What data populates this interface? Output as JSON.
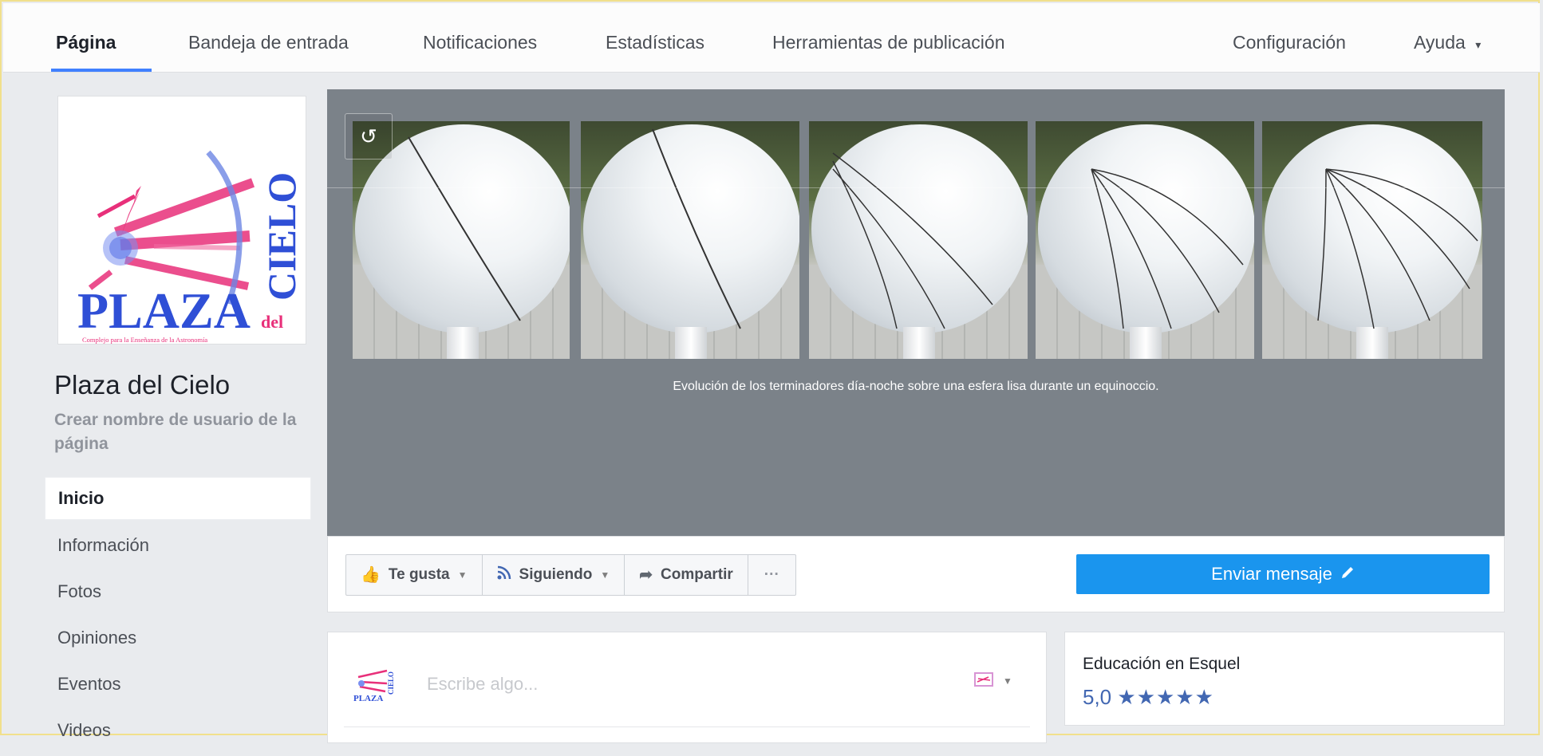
{
  "topnav": {
    "tabs": [
      {
        "label": "Página"
      },
      {
        "label": "Bandeja de entrada"
      },
      {
        "label": "Notificaciones"
      },
      {
        "label": "Estadísticas"
      },
      {
        "label": "Herramientas de publicación"
      }
    ],
    "settings_label": "Configuración",
    "help_label": "Ayuda",
    "help_caret": "▾"
  },
  "page": {
    "name": "Plaza del Cielo",
    "create_username": "Crear nombre de usuario de la página",
    "logo": {
      "word_plaza": "PLAZA",
      "word_del": "del",
      "word_cielo": "CIELO",
      "tagline": "Complejo para la Enseñanza de la Astronomía"
    }
  },
  "sidebar": {
    "items": [
      {
        "label": "Inicio"
      },
      {
        "label": "Información"
      },
      {
        "label": "Fotos"
      },
      {
        "label": "Opiniones"
      },
      {
        "label": "Eventos"
      },
      {
        "label": "Videos"
      }
    ]
  },
  "cover": {
    "caption": "Evolución de los terminadores día-noche sobre una esfera lisa durante un equinoccio.",
    "camera_icon": "↺"
  },
  "actions": {
    "like_label": "Te gusta",
    "follow_label": "Siguiendo",
    "share_label": "Compartir",
    "more_label": "···",
    "send_message_label": "Enviar mensaje"
  },
  "composer": {
    "placeholder": "Escribe algo..."
  },
  "rating": {
    "title": "Educación en Esquel",
    "score": "5,0",
    "stars": "★★★★★"
  },
  "colors": {
    "accent": "#4080ff",
    "send_button": "#1a95ee",
    "cover_bg": "#7b8289",
    "page_bg": "#e9ebee",
    "logo_pink": "#e8307a",
    "logo_blue": "#2f4fd6"
  }
}
